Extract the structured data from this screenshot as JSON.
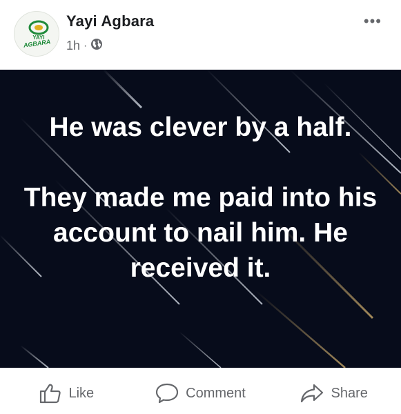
{
  "post": {
    "author": "Yayi Agbara",
    "time": "1h",
    "separator": "·",
    "privacy_icon": "globe-icon",
    "more_label": "•••",
    "avatar_text": "YAYI AGBARA",
    "body_line1": "He was clever by a half.",
    "body_line2": "They made me paid into his account to nail him. He received it."
  },
  "actions": {
    "like_label": "Like",
    "comment_label": "Comment",
    "share_label": "Share"
  },
  "colors": {
    "image_bg": "#070c1b",
    "text_secondary": "#65676b",
    "avatar_green": "#1f8a3a",
    "avatar_gold": "#e0b020"
  }
}
